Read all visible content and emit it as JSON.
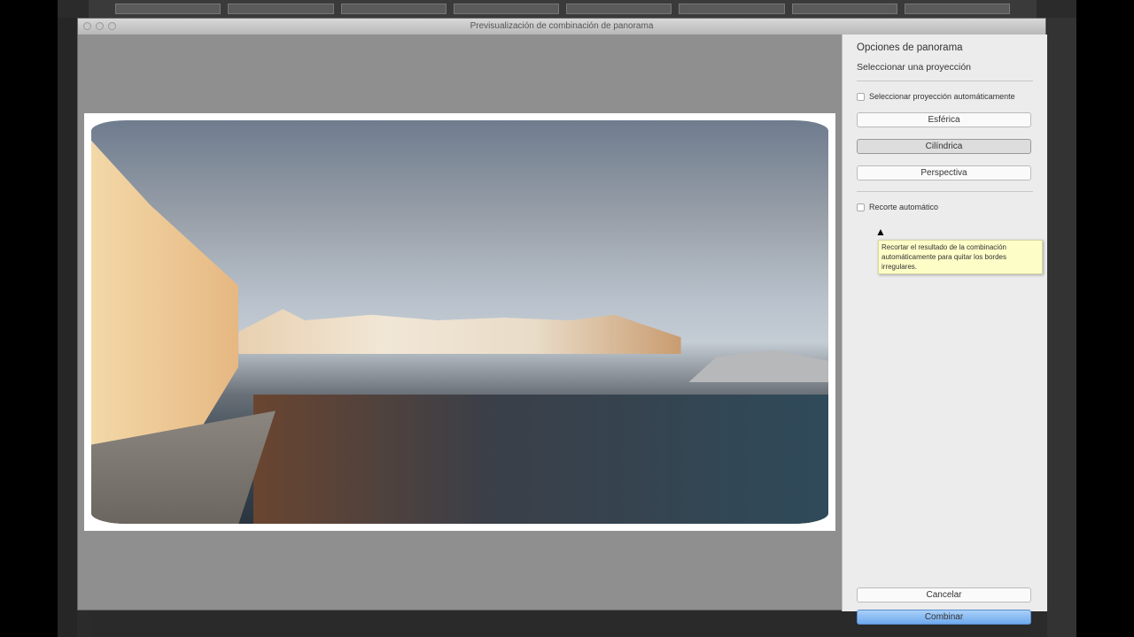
{
  "window": {
    "title": "Previsualización de combinación de panorama"
  },
  "panel": {
    "title": "Opciones de panorama",
    "projection_heading": "Seleccionar una proyección",
    "auto_projection_label": "Seleccionar proyección automáticamente",
    "projections": [
      "Esférica",
      "Cilíndrica",
      "Perspectiva"
    ],
    "selected_projection": "Cilíndrica",
    "auto_crop_label": "Recorte automático",
    "tooltip": "Recortar el resultado de la combinación automáticamente para quitar los bordes irregulares.",
    "cancel_label": "Cancelar",
    "combine_label": "Combinar"
  },
  "colors": {
    "accent": "#6fa9ee",
    "tooltip_bg": "#fdfdc8"
  }
}
